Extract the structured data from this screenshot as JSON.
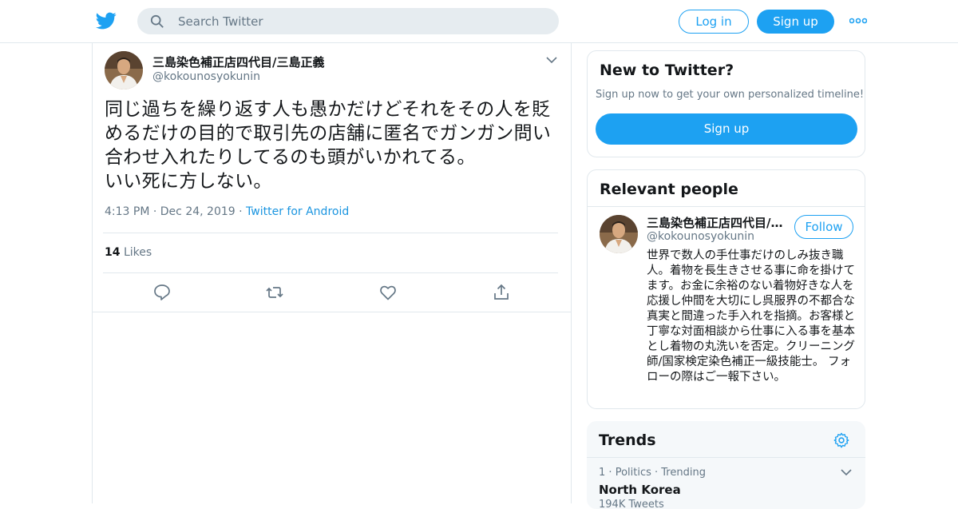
{
  "header": {
    "search_placeholder": "Search Twitter",
    "login_label": "Log in",
    "signup_label": "Sign up",
    "brand_color": "#1da1f2"
  },
  "tweet": {
    "author_name": "三島染色補正店四代目/三島正義",
    "author_handle": "@kokounosyokunin",
    "text": "同じ過ちを繰り返す人も愚かだけどそれをその人を貶めるだけの目的で取引先の店舗に匿名でガンガン問い合わせ入れたりしてるのも頭がいかれてる。\nいい死に方しない。",
    "time": "4:13 PM",
    "date": "Dec 24, 2019",
    "separator": "·",
    "source": "Twitter for Android",
    "likes_count": "14",
    "likes_label": "Likes",
    "actions": [
      "reply-icon",
      "retweet-icon",
      "like-icon",
      "share-icon"
    ]
  },
  "new_to_twitter": {
    "title": "New to Twitter?",
    "subtitle": "Sign up now to get your own personalized timeline!",
    "button": "Sign up"
  },
  "relevant_people": {
    "title": "Relevant people",
    "name": "三島染色補正店四代目/三島正義",
    "handle": "@kokounosyokunin",
    "follow_label": "Follow",
    "bio": "世界で数人の手仕事だけのしみ抜き職人。着物を長生きさせる事に命を掛けてます。お金に余裕のない着物好きな人を応援し仲間を大切にし呉服界の不都合な真実と間違った手入れを指摘。お客様と丁寧な対面相談から仕事に入る事を基本とし着物の丸洗いを否定。クリーニング師/国家検定染色補正一級技能士。 フォローの際はご一報下さい。"
  },
  "trends": {
    "title": "Trends",
    "items": [
      {
        "rank": "1",
        "category": "Politics",
        "status": "Trending",
        "name": "North Korea",
        "count": "194K Tweets"
      }
    ]
  }
}
